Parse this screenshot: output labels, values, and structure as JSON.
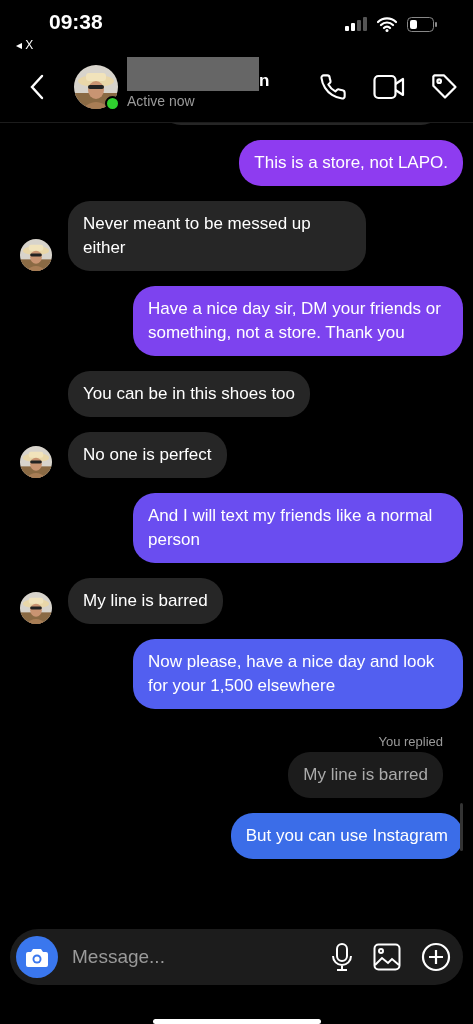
{
  "status_bar": {
    "time": "09:38",
    "back_app": "◂ X"
  },
  "header": {
    "name_visible": "n",
    "name_redacted": true,
    "presence": "Active now",
    "online": true
  },
  "messages": [
    {
      "kind": "stub"
    },
    {
      "kind": "outgoing",
      "text": "This is a store, not LAPO."
    },
    {
      "kind": "incoming",
      "text": "Never meant to be messed up either",
      "avatar": true
    },
    {
      "kind": "outgoing",
      "text": "Have a nice day sir, DM your friends or something, not a store. Thank you"
    },
    {
      "kind": "incoming",
      "text": "You can be in this shoes too",
      "avatar": false
    },
    {
      "kind": "incoming",
      "text": "No one is perfect",
      "avatar": true
    },
    {
      "kind": "outgoing",
      "text": "And I will text my friends like a normal person"
    },
    {
      "kind": "incoming",
      "text": "My line is barred",
      "avatar": true
    },
    {
      "kind": "outgoing",
      "text": "Now please, have a nice day and look for your 1,500 elsewhere"
    },
    {
      "kind": "reply_label",
      "text": "You replied"
    },
    {
      "kind": "quoted",
      "text": "My line is barred"
    },
    {
      "kind": "outgoing",
      "text": "But you can use Instagram"
    }
  ],
  "composer": {
    "placeholder": "Message..."
  }
}
